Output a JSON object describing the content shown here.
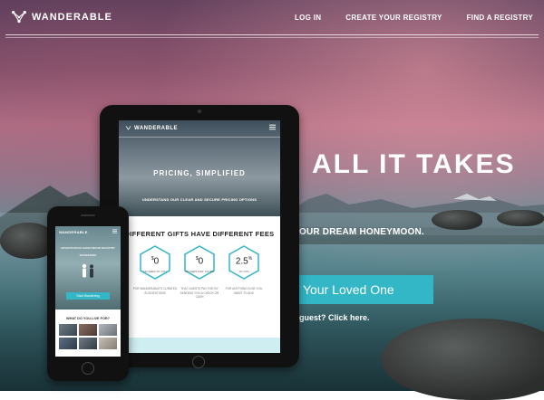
{
  "brand": {
    "name": "WANDERABLE"
  },
  "nav": {
    "items": [
      {
        "label": "LOG IN"
      },
      {
        "label": "CREATE YOUR REGISTRY"
      },
      {
        "label": "FIND A REGISTRY"
      }
    ]
  },
  "hero": {
    "title": "ALL IT TAKES",
    "subtitle": "OUR DREAM HONEYMOON.",
    "cta_label": "Your Loved One",
    "link_text": "guest? Click here."
  },
  "tablet": {
    "brand": "WANDERABLE",
    "hero_title": "PRICING, SIMPLIFIED",
    "hero_subtitle": "UNDERSTAND OUR CLEAR AND SECURE PRICING OPTIONS",
    "section_heading": "DIFFERENT GIFTS HAVE DIFFERENT FEES",
    "fees": [
      {
        "value": "0",
        "prefix": "$",
        "suffix": "",
        "caption": "NO FEES TO YOU",
        "description": "FOR WANDERABLE'S CURATED SUGGESTIONS"
      },
      {
        "value": "0",
        "prefix": "$",
        "suffix": "",
        "caption": "NO FEES FOR YOURS",
        "description": "THAT GUESTS PAY FOR BY SENDING YOU A CHECK OR CASH"
      },
      {
        "value": "2.5",
        "prefix": "",
        "suffix": "%",
        "caption": "TO YOU",
        "description": "FOR ANYTHING ELSE YOU WANT TO ADD"
      }
    ]
  },
  "phone": {
    "brand": "WANDERABLE",
    "hero_line1": "ADVENTUROUS HONEYMOON REGISTRY",
    "hero_line2": "WANDERING",
    "cta_label": "Start Wandering",
    "question": "WHAT DO YOU LIVE FOR?"
  },
  "colors": {
    "accent": "#33b6c6",
    "tablet_footer": "#cfeef1"
  }
}
